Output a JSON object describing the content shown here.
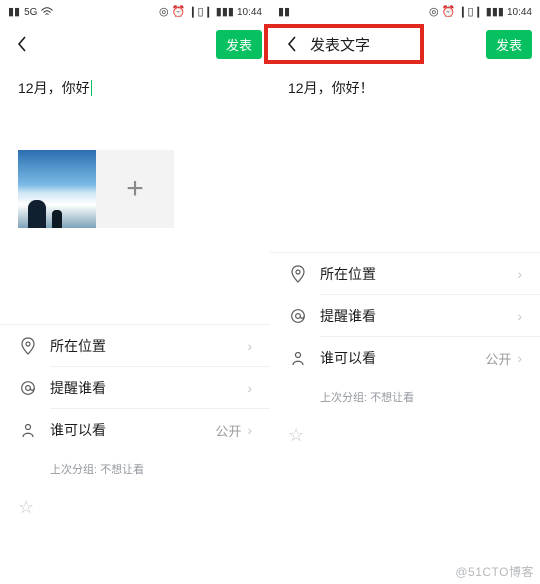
{
  "status": {
    "signal_label": "5G",
    "time": "10:44",
    "icons": [
      "eye-off",
      "alarm",
      "vibrate",
      "battery"
    ]
  },
  "left_phone": {
    "publish_label": "发表",
    "compose_text": "12月，你好",
    "options": {
      "location": "所在位置",
      "mention": "提醒谁看",
      "visibility": "谁可以看",
      "visibility_value": "公开"
    },
    "last_group": "上次分组: 不想让看"
  },
  "right_phone": {
    "top_title": "发表文字",
    "publish_label": "发表",
    "compose_text": "12月，你好！",
    "options": {
      "location": "所在位置",
      "mention": "提醒谁看",
      "visibility": "谁可以看",
      "visibility_value": "公开"
    },
    "last_group": "上次分组: 不想让看"
  },
  "watermark": "@51CTO博客"
}
